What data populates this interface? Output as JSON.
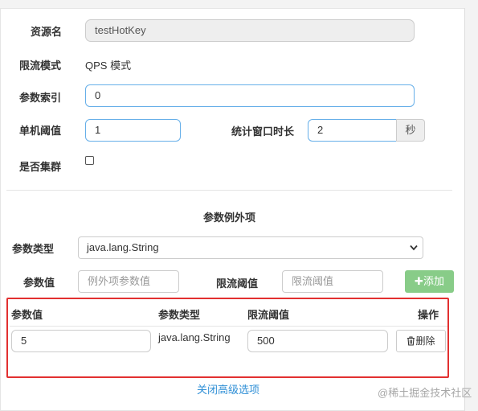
{
  "form": {
    "resource_label": "资源名",
    "resource_value": "testHotKey",
    "mode_label": "限流模式",
    "mode_value": "QPS 模式",
    "param_index_label": "参数索引",
    "param_index_value": "0",
    "threshold_label": "单机阈值",
    "threshold_value": "1",
    "window_label": "统计窗口时长",
    "window_value": "2",
    "window_unit": "秒",
    "cluster_label": "是否集群",
    "cluster_checked": false
  },
  "exceptions": {
    "section_title": "参数例外项",
    "type_label": "参数类型",
    "type_selected": "java.lang.String",
    "value_label": "参数值",
    "value_placeholder": "例外项参数值",
    "limit_label": "限流阈值",
    "limit_placeholder": "限流阈值",
    "add_label": "添加"
  },
  "table": {
    "headers": [
      "参数值",
      "参数类型",
      "限流阈值",
      "操作"
    ],
    "rows": [
      {
        "value": "5",
        "type": "java.lang.String",
        "limit": "500",
        "action": "删除"
      }
    ]
  },
  "footer": {
    "toggle_link": "关闭高级选项",
    "watermark": "@稀土掘金技术社区"
  },
  "colors": {
    "focus_border": "#66afe9",
    "add_button": "#88cc88",
    "highlight_box": "#e23030",
    "link": "#2f8fd6"
  }
}
